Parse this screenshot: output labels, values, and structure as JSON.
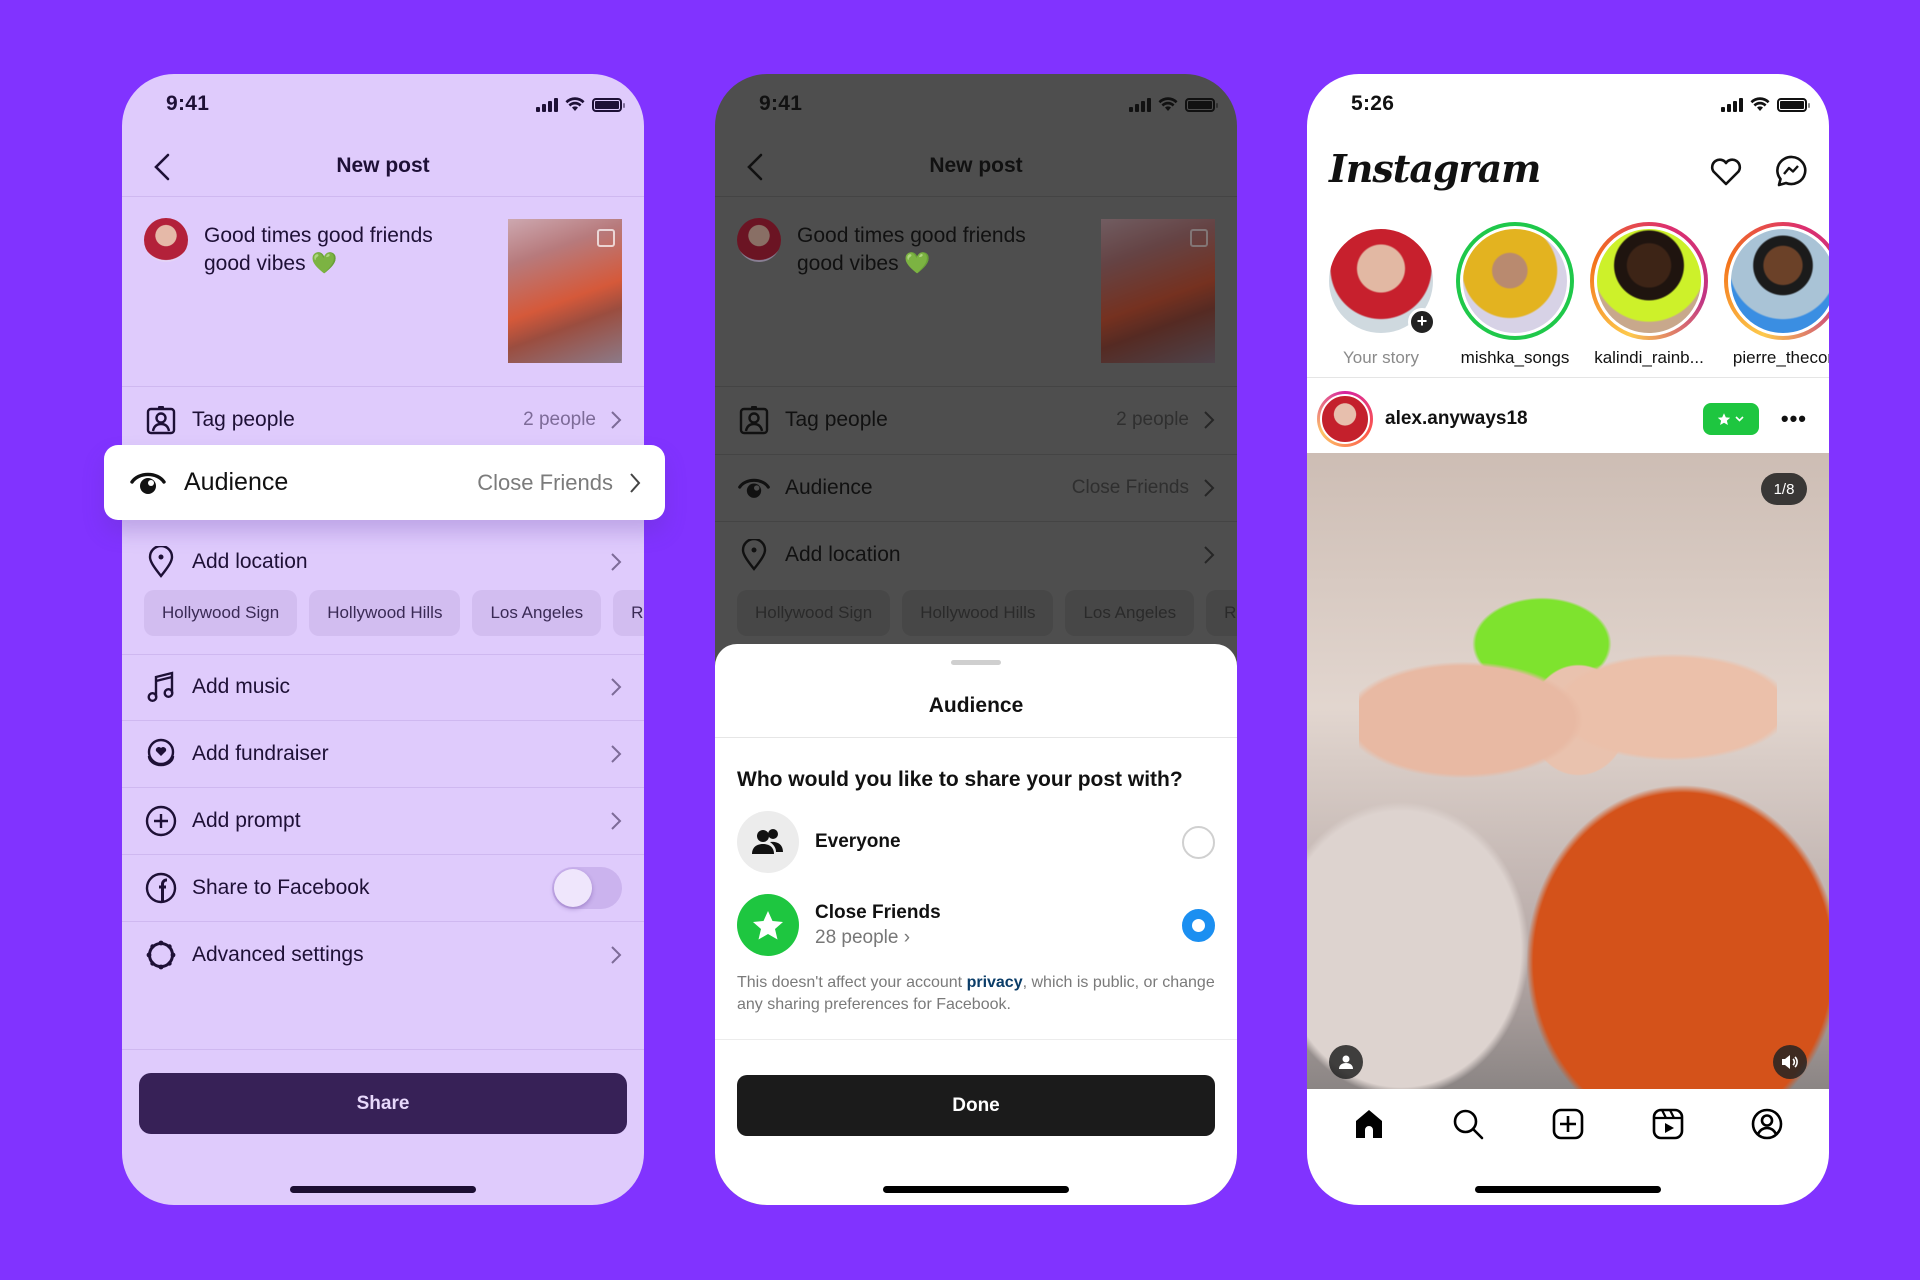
{
  "colors": {
    "background": "#8133ff",
    "panel_lavender": "#dfcbfc",
    "share_button": "#372157",
    "close_friends_green": "#1ec640",
    "radio_selected": "#1b8ff1"
  },
  "new_post_screen": {
    "status_time": "9:41",
    "title": "New post",
    "caption_line1": "Good times good friends",
    "caption_line2": "good vibes",
    "caption_emoji": "💚",
    "rows": {
      "tag_people": {
        "label": "Tag people",
        "value": "2 people"
      },
      "audience": {
        "label": "Audience",
        "value": "Close Friends"
      },
      "add_location": {
        "label": "Add location"
      },
      "add_music": {
        "label": "Add music"
      },
      "add_fundraiser": {
        "label": "Add fundraiser"
      },
      "add_prompt": {
        "label": "Add prompt"
      },
      "share_to_facebook": {
        "label": "Share to Facebook",
        "toggle_on": false
      },
      "advanced_settings": {
        "label": "Advanced settings"
      }
    },
    "location_chips": [
      "Hollywood Sign",
      "Hollywood Hills",
      "Los Angeles",
      "R"
    ],
    "share_button": "Share"
  },
  "audience_sheet": {
    "title": "Audience",
    "question": "Who would you like to share your post with?",
    "options": [
      {
        "name": "Everyone",
        "icon": "people-icon",
        "selected": false
      },
      {
        "name": "Close Friends",
        "sub": "28 people ›",
        "icon": "star-icon",
        "selected": true
      }
    ],
    "note_before": "This doesn't affect your account ",
    "note_link": "privacy",
    "note_after": ", which is public, or change any sharing preferences for Facebook.",
    "done_button": "Done"
  },
  "feed_screen": {
    "status_time": "5:26",
    "logo": "Instagram",
    "stories": [
      {
        "name": "Your story",
        "own": true
      },
      {
        "name": "mishka_songs",
        "ring": "close-friends"
      },
      {
        "name": "kalindi_rainb...",
        "ring": "gradient"
      },
      {
        "name": "pierre_thecor",
        "ring": "gradient"
      }
    ],
    "post": {
      "username": "alex.anyways18",
      "counter": "1/8",
      "more": "•••"
    },
    "tabs": [
      "home",
      "search",
      "create",
      "reels",
      "profile"
    ]
  }
}
